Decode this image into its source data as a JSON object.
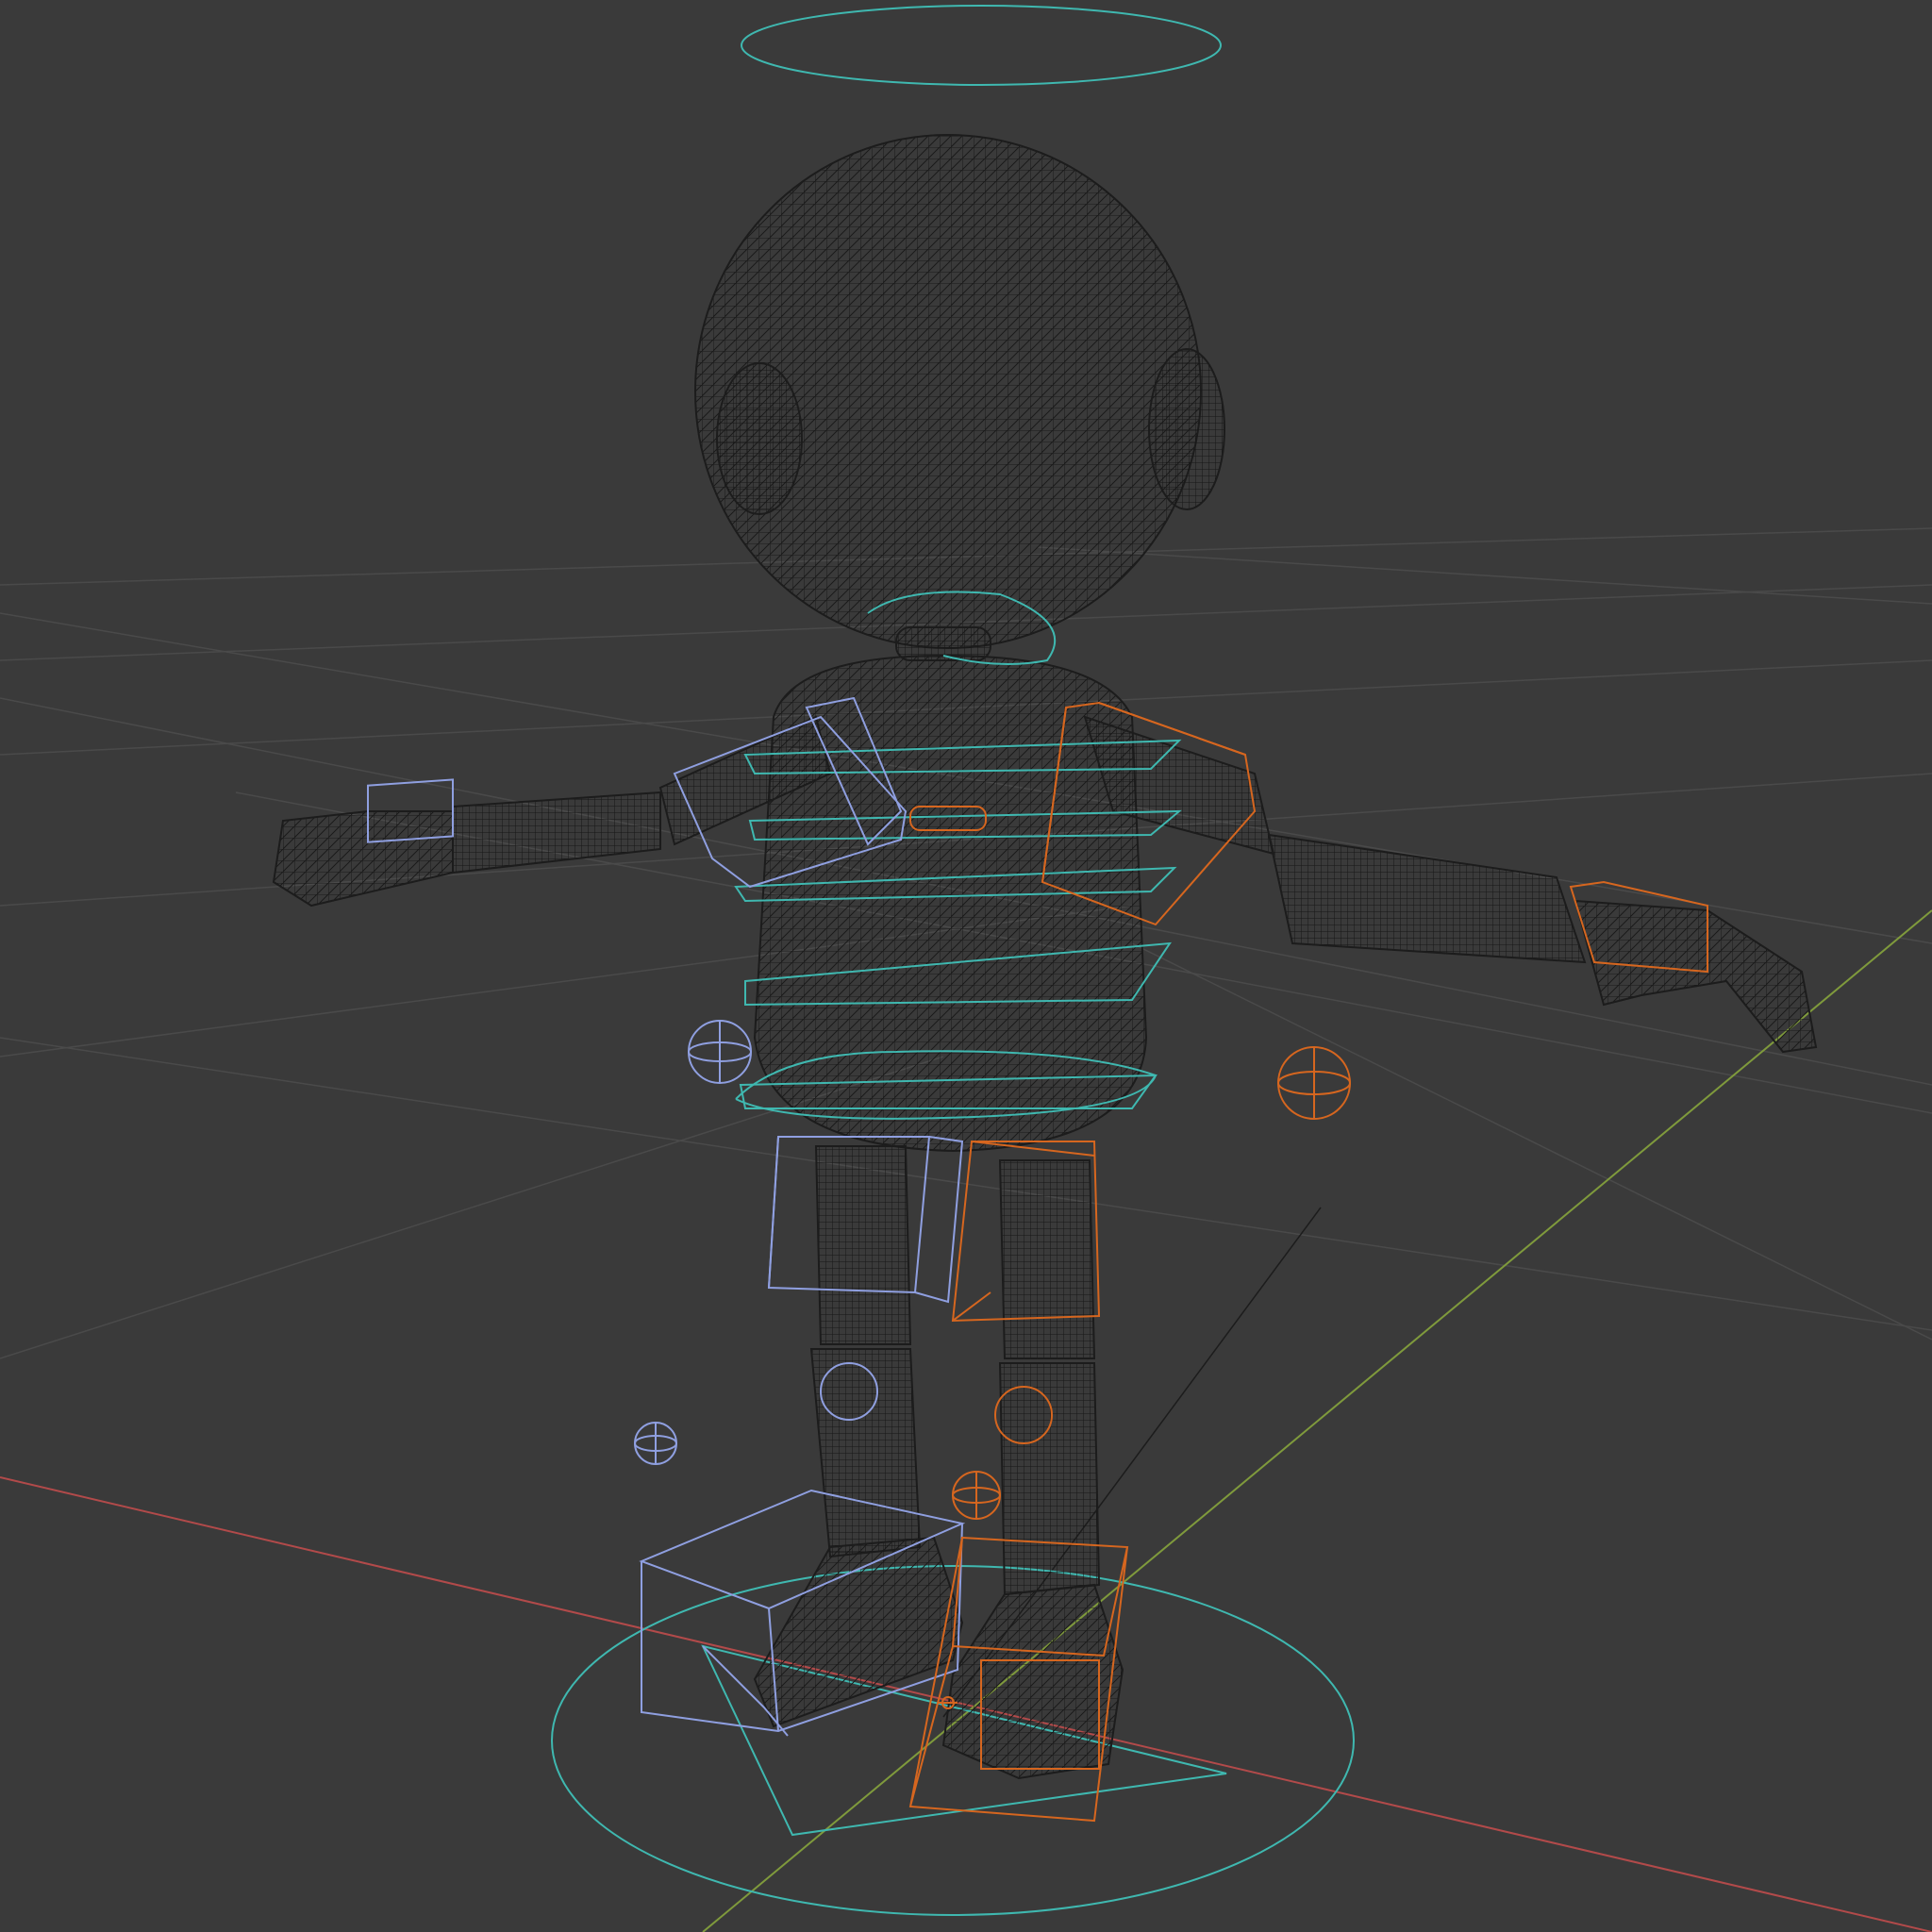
{
  "viewport": {
    "mode": "wireframe",
    "colors": {
      "background": "#3a3a3a",
      "grid_line": "#4a4a4a",
      "axis_x": "#b24a4a",
      "axis_y": "#7f9a3c",
      "mesh": "#1c1c1c",
      "control_center": "#3fb8b0",
      "control_left": "#8f9fe0",
      "control_right": "#d6661f"
    }
  },
  "character": {
    "type": "rigged-character-mesh",
    "pose": "A-pose"
  }
}
